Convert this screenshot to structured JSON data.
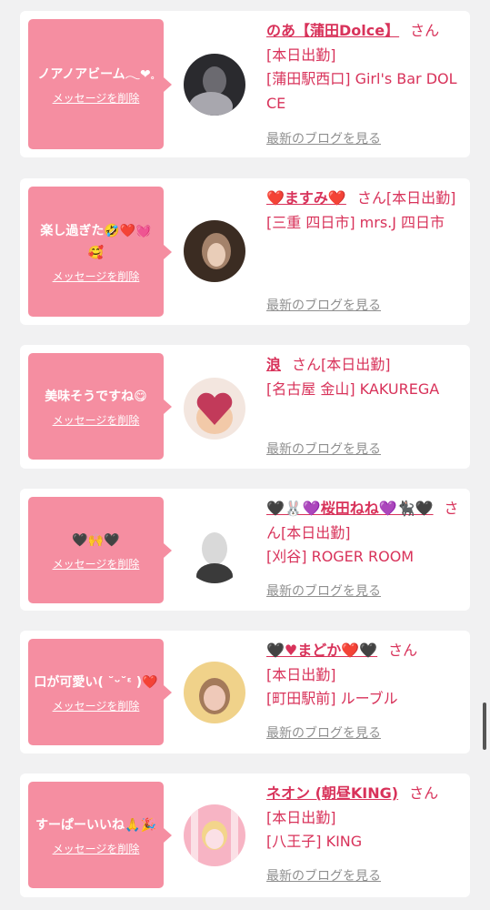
{
  "cards": [
    {
      "message": "ノアノアビーム𓂃❤︎𓈒",
      "delete_label": "メッセージを削除",
      "name": "のあ【蒲田Dolce】",
      "honorific": "さん",
      "status": "[本日出勤]",
      "store": "[蒲田駅西口] Girl's Bar DOLCE",
      "blog_label": "最新のブログを見る",
      "avatar_colors": [
        "#2a2a2e",
        "#6b6a70",
        "#a8a7ae"
      ]
    },
    {
      "message": "楽し過ぎた🤣❤️💓🥰",
      "delete_label": "メッセージを削除",
      "name": "❤️ますみ❤️",
      "honorific": "さん",
      "status": "[本日出勤]",
      "store": "[三重 四日市] mrs.J 四日市",
      "blog_label": "最新のブログを見る",
      "avatar_colors": [
        "#3b2c22",
        "#a4826a",
        "#e9cdb8"
      ]
    },
    {
      "message": "美味そうですね😋",
      "delete_label": "メッセージを削除",
      "name": "浪",
      "honorific": "さん",
      "status": "[本日出勤]",
      "store": "[名古屋 金山] KAKUREGA",
      "blog_label": "最新のブログを見る",
      "avatar_colors": [
        "#f3e6df",
        "#c23a5a",
        "#f2c9a8"
      ]
    },
    {
      "message": "🖤🙌🖤",
      "delete_label": "メッセージを削除",
      "name": "🖤🐰💜桜田ねね💜🐈‍⬛🖤",
      "honorific": "さん",
      "status": "[本日出勤]",
      "store": "[刈谷] ROGER ROOM",
      "blog_label": "最新のブログを見る",
      "avatar_colors": [
        "#ffffff",
        "#d9d9d9",
        "#3a3a3a"
      ]
    },
    {
      "message": "口が可愛い( ˘ᵕ˘ᵋ )❤️",
      "delete_label": "メッセージを削除",
      "name": "🖤♥まどか❤️🖤",
      "honorific": "さん",
      "status": "[本日出勤]",
      "store": "[町田駅前] ルーブル",
      "blog_label": "最新のブログを見る",
      "avatar_colors": [
        "#f0d28a",
        "#efc9b9",
        "#a47a5a"
      ]
    },
    {
      "message": "すーぱーいいね🙏🎉",
      "delete_label": "メッセージを削除",
      "name": "ネオン (朝昼KING)",
      "honorific": "さん",
      "status": "[本日出勤]",
      "store": "[八王子] KING",
      "blog_label": "最新のブログを見る",
      "avatar_colors": [
        "#f7b4c4",
        "#fbe0e6",
        "#f3d58b"
      ]
    }
  ]
}
